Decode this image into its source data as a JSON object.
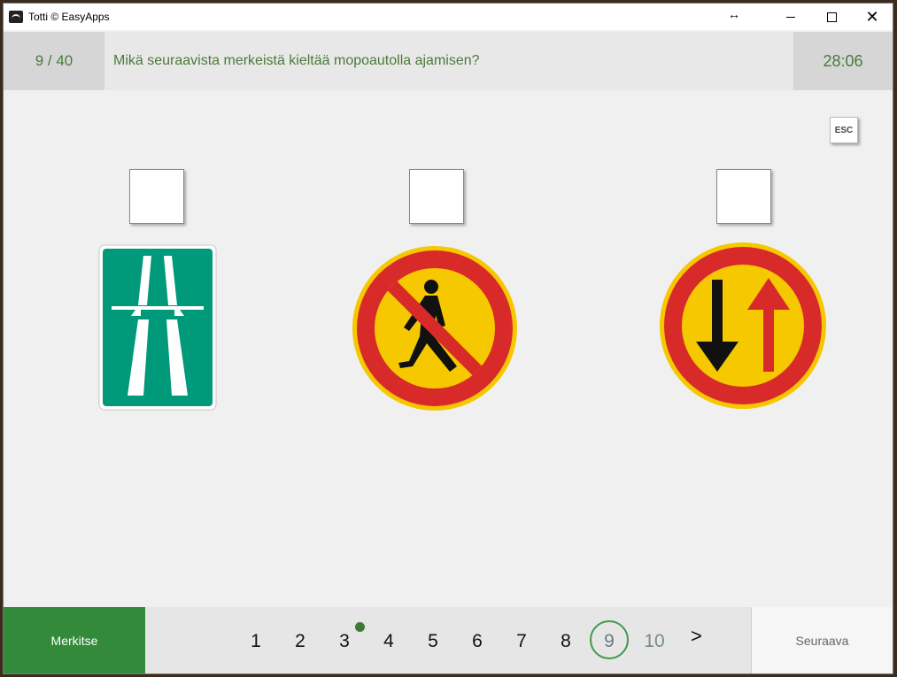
{
  "window": {
    "title": "Totti © EasyApps"
  },
  "header": {
    "counter": "9 / 40",
    "question": "Mikä seuraavista merkeistä kieltää mopoautolla ajamisen?",
    "timer": "28:06"
  },
  "esc_label": "ESC",
  "options": [
    {
      "sign": "motorway-sign",
      "checked": false
    },
    {
      "sign": "no-pedestrians-sign",
      "checked": false
    },
    {
      "sign": "priority-for-oncoming-traffic-sign",
      "checked": false
    }
  ],
  "footer": {
    "mark_label": "Merkitse",
    "next_label": "Seuraava",
    "pages": [
      "1",
      "2",
      "3",
      "4",
      "5",
      "6",
      "7",
      "8",
      "9",
      "10"
    ],
    "current_page": "9",
    "next_arrow": ">"
  },
  "colors": {
    "accent_green": "#338a3a",
    "text_green": "#4a7a3a",
    "motorway_green": "#009a7a",
    "sign_red": "#d92a2a",
    "sign_yellow": "#f5c800"
  }
}
